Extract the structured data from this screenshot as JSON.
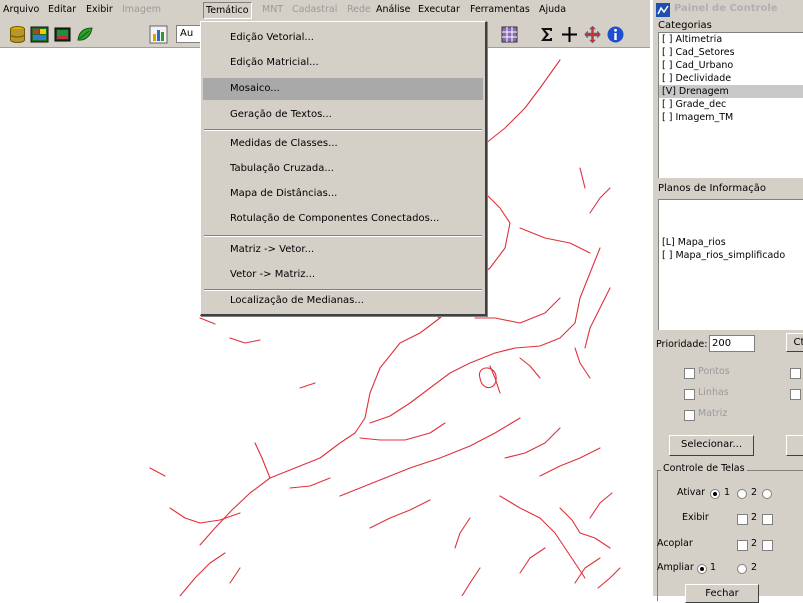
{
  "menubar": {
    "items": [
      {
        "label": "Arquivo"
      },
      {
        "label": "Editar"
      },
      {
        "label": "Exibir"
      },
      {
        "label": "Imagem"
      },
      {
        "label": "Temático"
      },
      {
        "label": "MNT"
      },
      {
        "label": "Cadastral"
      },
      {
        "label": "Rede"
      },
      {
        "label": "Análise"
      },
      {
        "label": "Executar"
      },
      {
        "label": "Ferramentas"
      },
      {
        "label": "Ajuda"
      }
    ]
  },
  "toolbar": {
    "combo_value": "Au"
  },
  "dropdown": {
    "items": [
      {
        "label": "Edição Vetorial..."
      },
      {
        "label": "Edição Matricial..."
      },
      {
        "label": "Mosaico..."
      },
      {
        "label": "Geração de Textos..."
      },
      {
        "label": "Medidas de Classes..."
      },
      {
        "label": "Tabulação Cruzada..."
      },
      {
        "label": "Mapa de Distâncias..."
      },
      {
        "label": "Rotulação de Componentes Conectados..."
      },
      {
        "label": "Matriz -> Vetor..."
      },
      {
        "label": "Vetor -> Matriz..."
      },
      {
        "label": "Localização de Medianas..."
      }
    ]
  },
  "panel": {
    "title": "Painel de Controle",
    "categorias_label": "Categorias",
    "categorias": [
      {
        "label": "[ ] Altimetria",
        "selected": false
      },
      {
        "label": "[ ] Cad_Setores",
        "selected": false
      },
      {
        "label": "[ ] Cad_Urbano",
        "selected": false
      },
      {
        "label": "[ ] Declividade",
        "selected": false
      },
      {
        "label": "[V] Drenagem",
        "selected": true
      },
      {
        "label": "[ ] Grade_dec",
        "selected": false
      },
      {
        "label": "[ ] Imagem_TM",
        "selected": false
      }
    ],
    "planos_label": "Planos de Informação",
    "planos": [
      {
        "label": "[L] Mapa_rios"
      },
      {
        "label": "[ ] Mapa_rios_simplificado"
      }
    ],
    "prioridade_label": "Prioridade:",
    "prioridade_value": "200",
    "prioridade_button": "Ct",
    "layers": [
      {
        "label": "Pontos"
      },
      {
        "label": "Linhas"
      },
      {
        "label": "Matriz"
      }
    ],
    "selecionar_button": "Selecionar...",
    "telas_label": "Controle de Telas",
    "ativar_label": "Ativar",
    "exibir_label": "Exibir",
    "acoplar_label": "Acoplar",
    "ampliar_label": "Ampliar",
    "opt1": "1",
    "opt2": "2",
    "fechar_button": "Fechar"
  }
}
